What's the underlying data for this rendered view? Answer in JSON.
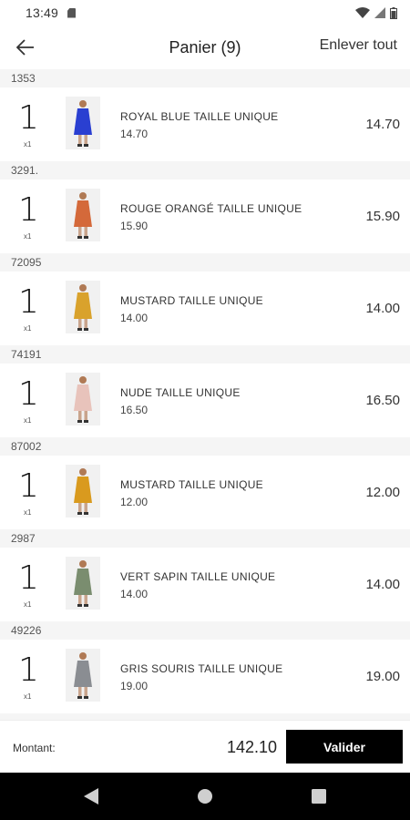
{
  "status_bar": {
    "time": "13:49"
  },
  "app_bar": {
    "title": "Panier (9)",
    "clear_label": "Enlever tout"
  },
  "cart": {
    "items": [
      {
        "ref": "1353",
        "qty": "1",
        "qty_sub": "x1",
        "name": "ROYAL BLUE TAILLE UNIQUE",
        "unit_price": "14.70",
        "price": "14.70",
        "color": "#2a3fd1"
      },
      {
        "ref": "3291.",
        "qty": "1",
        "qty_sub": "x1",
        "name": "ROUGE ORANGÉ TAILLE UNIQUE",
        "unit_price": "15.90",
        "price": "15.90",
        "color": "#d4693a"
      },
      {
        "ref": "72095",
        "qty": "1",
        "qty_sub": "x1",
        "name": "MUSTARD TAILLE UNIQUE",
        "unit_price": "14.00",
        "price": "14.00",
        "color": "#d9a22c"
      },
      {
        "ref": "74191",
        "qty": "1",
        "qty_sub": "x1",
        "name": "NUDE TAILLE UNIQUE",
        "unit_price": "16.50",
        "price": "16.50",
        "color": "#e8c3bb"
      },
      {
        "ref": "87002",
        "qty": "1",
        "qty_sub": "x1",
        "name": "MUSTARD TAILLE UNIQUE",
        "unit_price": "12.00",
        "price": "12.00",
        "color": "#d99a1e"
      },
      {
        "ref": "2987",
        "qty": "1",
        "qty_sub": "x1",
        "name": "VERT SAPIN TAILLE UNIQUE",
        "unit_price": "14.00",
        "price": "14.00",
        "color": "#7a8d6f"
      },
      {
        "ref": "49226",
        "qty": "1",
        "qty_sub": "x1",
        "name": "GRIS SOURIS TAILLE UNIQUE",
        "unit_price": "19.00",
        "price": "19.00",
        "color": "#8a8d92"
      }
    ]
  },
  "footer": {
    "amount_label": "Montant:",
    "amount_value": "142.10",
    "validate_label": "Valider"
  },
  "colors": {
    "accent": "#000000",
    "header_bg": "#f5f5f5"
  },
  "icons": [
    "back-arrow-icon",
    "wifi-icon",
    "signal-icon",
    "battery-icon",
    "nav-back-icon",
    "nav-home-icon",
    "nav-recents-icon"
  ]
}
